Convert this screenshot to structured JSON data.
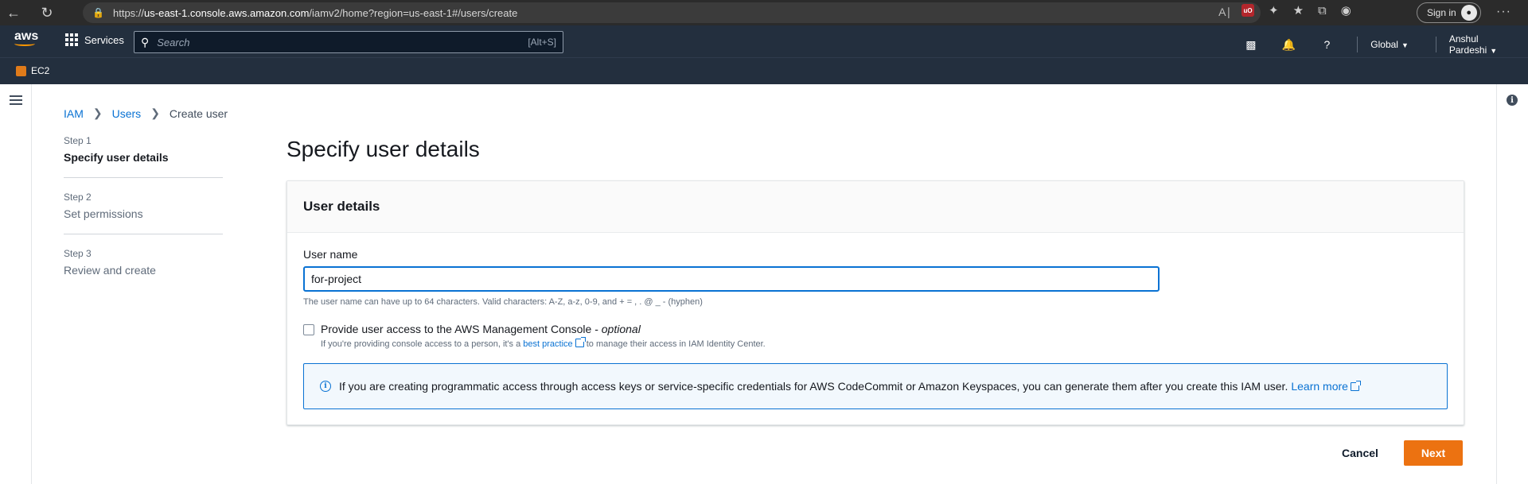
{
  "browser": {
    "url_prefix": "https://",
    "url_host": "us-east-1.console.aws.amazon.com",
    "url_path": "/iamv2/home?region=us-east-1#/users/create",
    "sign_in_label": "Sign in",
    "extension_badge": "uO"
  },
  "aws_nav": {
    "logo_text": "aws",
    "services_label": "Services",
    "search_placeholder": "Search",
    "search_shortcut": "[Alt+S]",
    "region_label": "Global",
    "user_label": "Anshul Pardeshi",
    "favorite": "EC2"
  },
  "breadcrumb": {
    "items": [
      "IAM",
      "Users"
    ],
    "current": "Create user"
  },
  "steps": [
    {
      "number": "Step 1",
      "title": "Specify user details",
      "active": true
    },
    {
      "number": "Step 2",
      "title": "Set permissions",
      "active": false
    },
    {
      "number": "Step 3",
      "title": "Review and create",
      "active": false
    }
  ],
  "page_title": "Specify user details",
  "user_details": {
    "header": "User details",
    "user_name_label": "User name",
    "user_name_value": "for-project",
    "constraint_text": "The user name can have up to 64 characters. Valid characters: A-Z, a-z, 0-9, and + = , . @ _ - (hyphen)",
    "console_access_label": "Provide user access to the AWS Management Console -",
    "console_access_optional": "optional",
    "console_access_checked": false,
    "console_desc_before": "If you're providing console access to a person, it's a",
    "console_desc_link": "best practice",
    "console_desc_after": "to manage their access in IAM Identity Center.",
    "alert_text": "If you are creating programmatic access through access keys or service-specific credentials for AWS CodeCommit or Amazon Keyspaces, you can generate them after you create this IAM user.",
    "alert_link": "Learn more"
  },
  "actions": {
    "cancel_label": "Cancel",
    "next_label": "Next"
  },
  "colors": {
    "primary_button": "#ec7211",
    "link": "#0972d3",
    "nav_bg": "#232f3e"
  }
}
